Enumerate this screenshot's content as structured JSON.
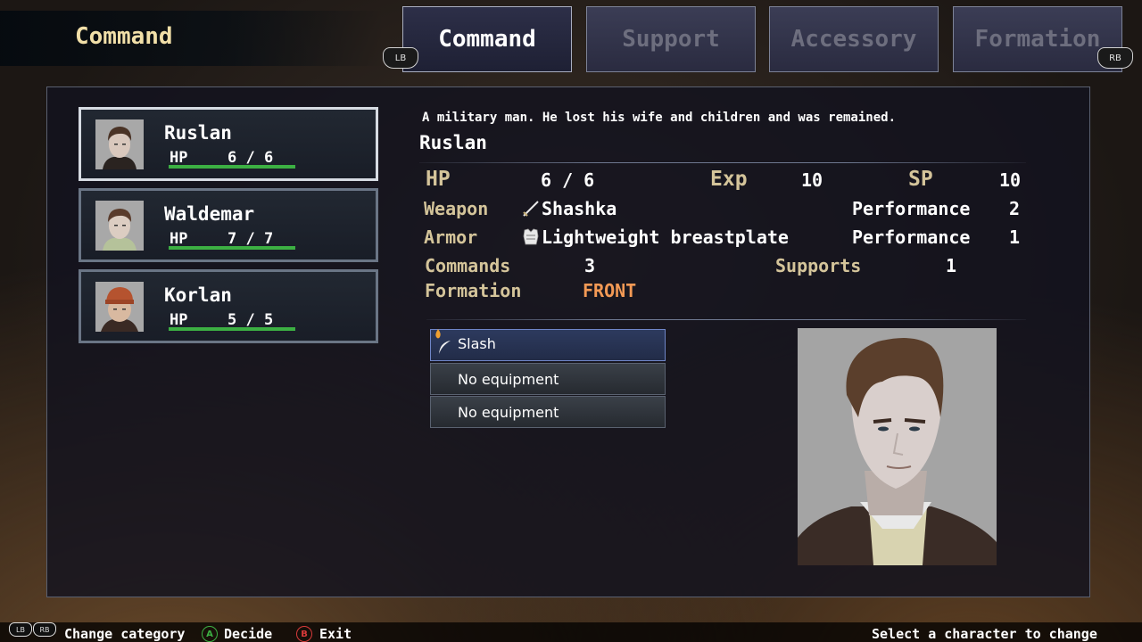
{
  "header": {
    "title": "Command",
    "tabs": [
      {
        "label": "Command",
        "active": true
      },
      {
        "label": "Support",
        "active": false
      },
      {
        "label": "Accessory",
        "active": false
      },
      {
        "label": "Formation",
        "active": false
      }
    ],
    "lb": "LB",
    "rb": "RB"
  },
  "characters": [
    {
      "name": "Ruslan",
      "hp_label": "HP",
      "hp": "6 / 6",
      "hp_fraction": 1.0,
      "selected": true
    },
    {
      "name": "Waldemar",
      "hp_label": "HP",
      "hp": "7 / 7",
      "hp_fraction": 1.0,
      "selected": false
    },
    {
      "name": "Korlan",
      "hp_label": "HP",
      "hp": "5 / 5",
      "hp_fraction": 1.0,
      "selected": false
    }
  ],
  "detail": {
    "description": "A military man. He lost his wife and children and was remained.",
    "name": "Ruslan",
    "hp_label": "HP",
    "hp": "6 / 6",
    "exp_label": "Exp",
    "exp": "10",
    "sp_label": "SP",
    "sp": "10",
    "weapon_label": "Weapon",
    "weapon": "Shashka",
    "weapon_perf_label": "Performance",
    "weapon_perf": "2",
    "armor_label": "Armor",
    "armor": "Lightweight breastplate",
    "armor_perf_label": "Performance",
    "armor_perf": "1",
    "commands_label": "Commands",
    "commands": "3",
    "supports_label": "Supports",
    "supports": "1",
    "formation_label": "Formation",
    "formation": "FRONT",
    "formation_color": "#f39a55"
  },
  "skills": [
    {
      "label": "Slash",
      "icon": "slash-icon",
      "selected": true
    },
    {
      "label": "No equipment",
      "selected": false
    },
    {
      "label": "No equipment",
      "selected": false
    }
  ],
  "footer": {
    "lb": "LB",
    "rb": "RB",
    "change_category": "Change category",
    "a_btn": "A",
    "decide": "Decide",
    "b_btn": "B",
    "exit": "Exit",
    "hint": "Select a character to change settings"
  }
}
